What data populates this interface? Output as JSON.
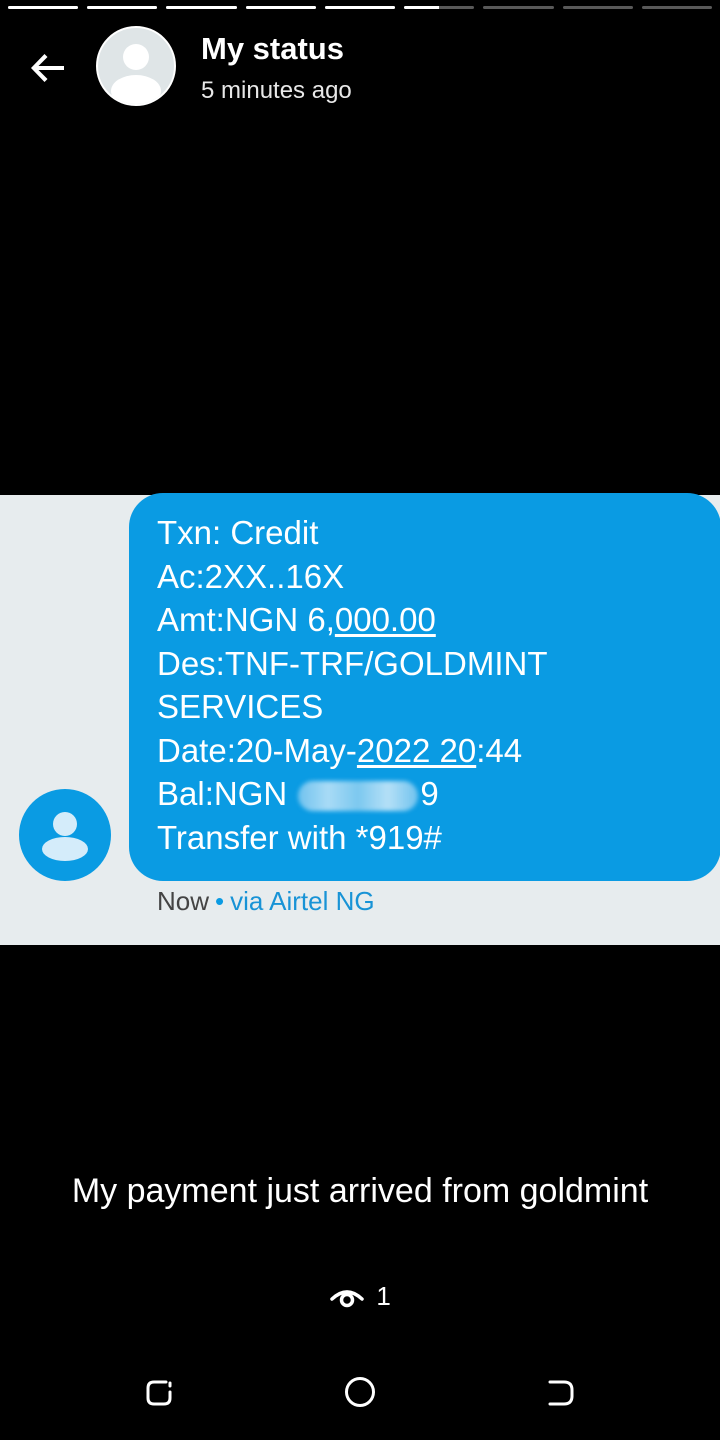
{
  "status": {
    "title": "My status",
    "timestamp": "5 minutes ago",
    "progress_segments": [
      1,
      1,
      1,
      1,
      1,
      0.5,
      0,
      0,
      0
    ],
    "caption": "My payment just arrived from goldmint",
    "views_count": "1"
  },
  "sms": {
    "lines": {
      "txn": "Txn: Credit",
      "ac": "Ac:2XX..16X",
      "amt_prefix": "Amt:NGN 6,",
      "amt_underlined": "000.00",
      "des1": "Des:TNF-TRF/GOLDMINT",
      "des2": "SERVICES",
      "date_prefix": "Date:20-May-",
      "date_underlined": "2022 20",
      "date_suffix": ":44",
      "bal_prefix": "Bal:NGN ",
      "bal_suffix": "9",
      "transfer": "Transfer with *919#"
    },
    "time": "Now",
    "separator": "•",
    "via": "via Airtel NG"
  },
  "colors": {
    "bubble": "#0a9be3",
    "background": "#000000",
    "screenshot_bg": "#e7ecee"
  },
  "icons": {
    "back": "arrow-left-icon",
    "avatar": "person-avatar-icon",
    "views": "eye-icon",
    "nav_recent": "recent-apps-icon",
    "nav_home": "home-circle-icon",
    "nav_back": "back-nav-icon"
  }
}
